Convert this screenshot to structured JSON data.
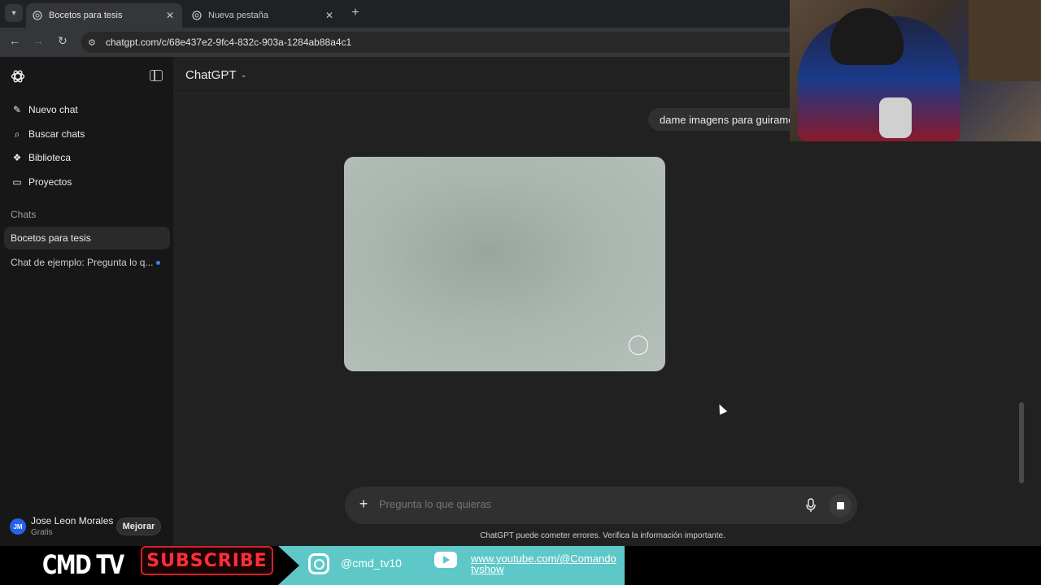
{
  "browser": {
    "tabs": [
      {
        "label": "Bocetos para tesis",
        "active": true
      },
      {
        "label": "Nueva pestaña",
        "active": false
      }
    ],
    "url": "chatgpt.com/c/68e437e2-9fc4-832c-903a-1284ab88a4c1"
  },
  "sidebar": {
    "items": [
      {
        "label": "Nuevo chat",
        "icon": "edit-icon"
      },
      {
        "label": "Buscar chats",
        "icon": "search-icon"
      },
      {
        "label": "Biblioteca",
        "icon": "library-icon"
      },
      {
        "label": "Proyectos",
        "icon": "folder-icon"
      }
    ],
    "section_title": "Chats",
    "chats": [
      {
        "label": "Bocetos para tesis",
        "selected": true
      },
      {
        "label": "Chat de ejemplo: Pregunta lo q...",
        "unread": true
      }
    ],
    "user": {
      "initials": "JM",
      "name": "Jose Leon Morales",
      "plan": "Gratis",
      "upgrade_label": "Mejorar"
    }
  },
  "main": {
    "model": "ChatGPT",
    "user_message": "dame imagens para guirame",
    "composer": {
      "placeholder": "Pregunta lo que quieras"
    },
    "disclaimer": "ChatGPT puede cometer errores. Verifica la información importante."
  },
  "banner": {
    "title": "CMD TV",
    "subscribe": "SUBSCRIBE",
    "instagram": "@cmd_tv10",
    "youtube": "www.youtube.com/@Comandotvshow"
  },
  "colors": {
    "sidebar_bg": "#171717",
    "main_bg": "#212121",
    "accent_dot": "#3b82f6",
    "banner_teal": "#5ec8c8",
    "subscribe_red": "#ff2d3a"
  }
}
